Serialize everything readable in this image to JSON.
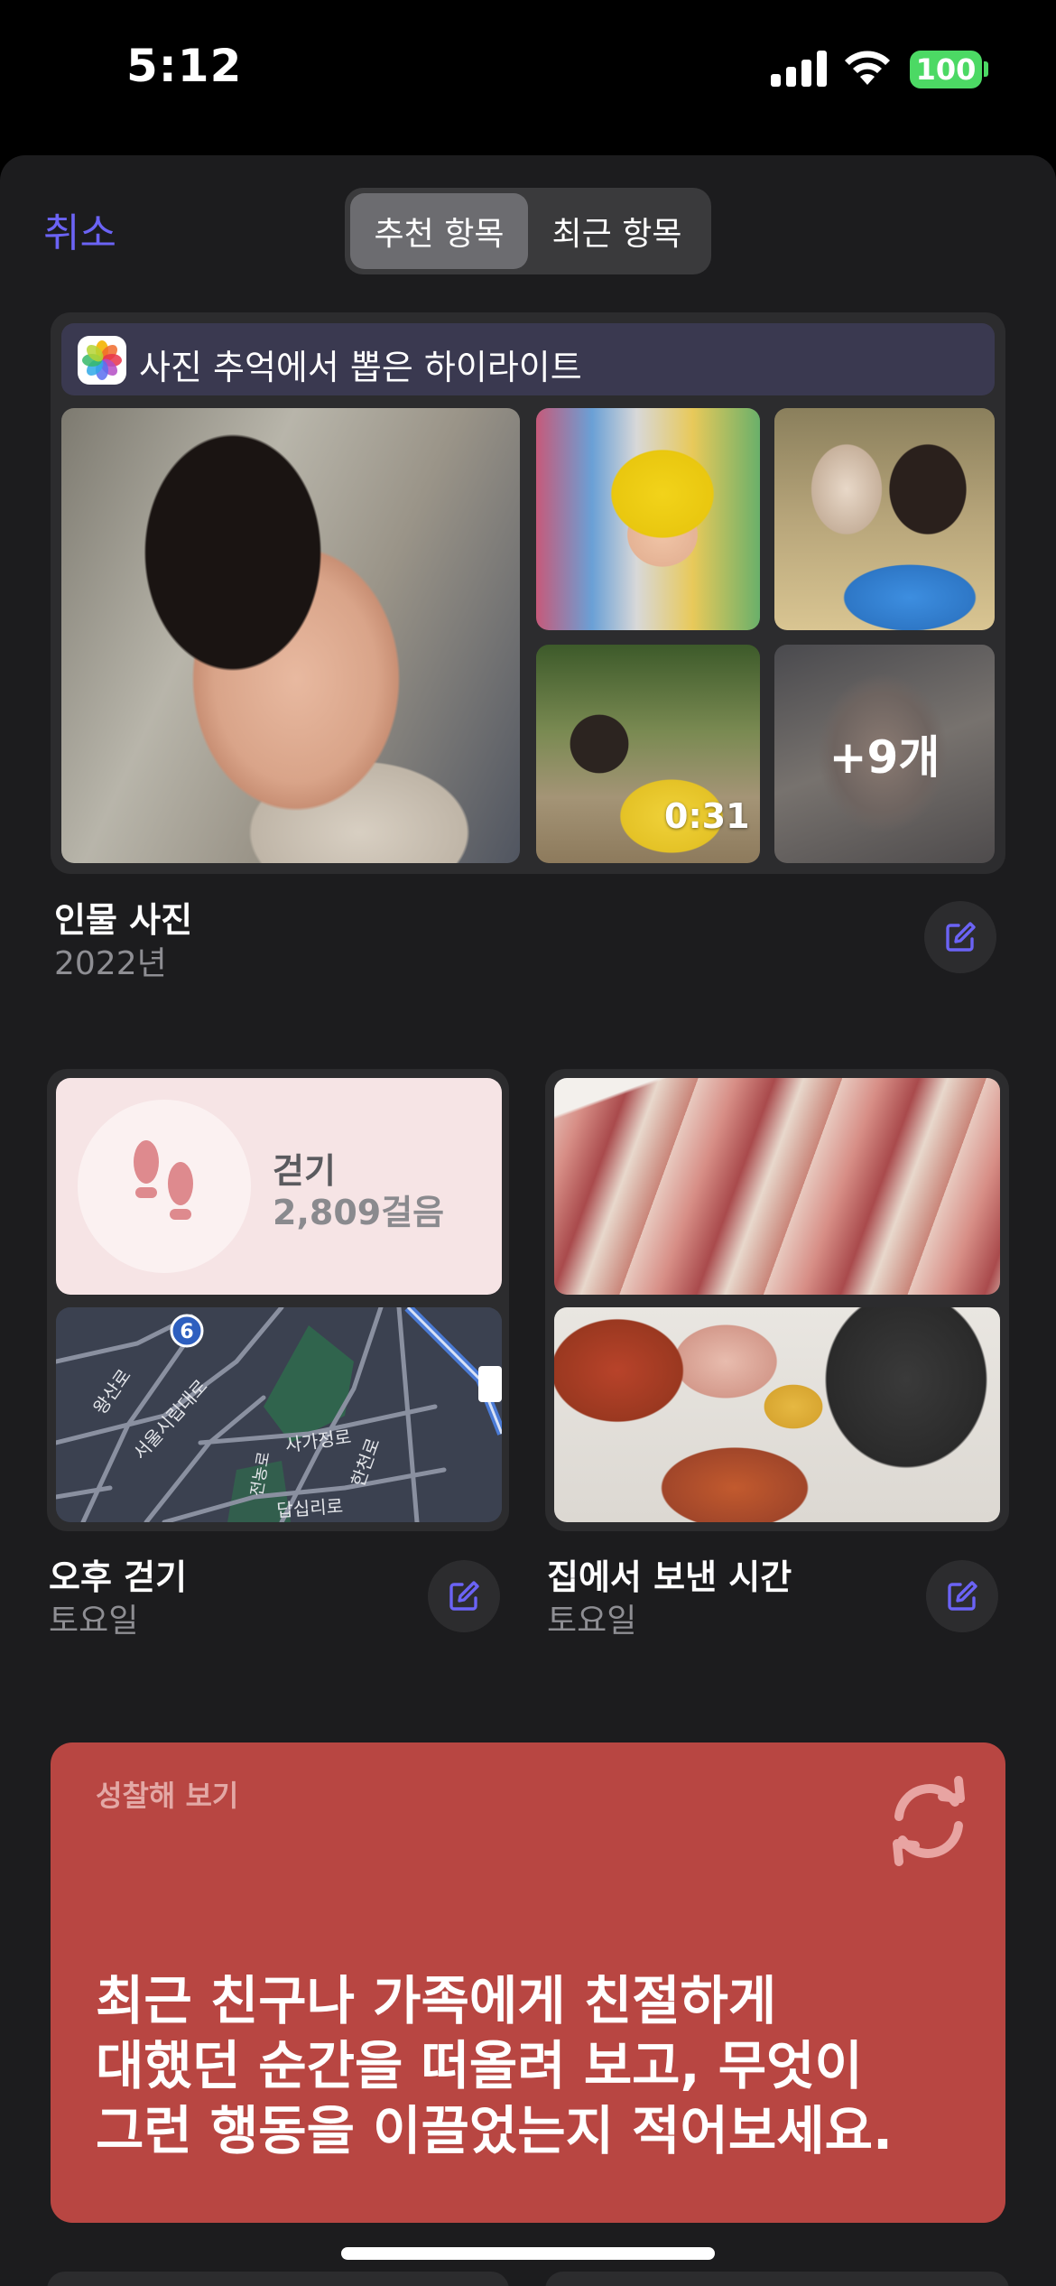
{
  "status_bar": {
    "time": "5:12",
    "battery": "100"
  },
  "header": {
    "cancel_label": "취소",
    "segments": [
      {
        "label": "추천 항목",
        "active": true
      },
      {
        "label": "최근 항목",
        "active": false
      }
    ]
  },
  "highlight_card": {
    "header_title": "사진 추억에서 뽑은 하이라이트",
    "video_duration": "0:31",
    "more_count": "+9개",
    "title": "인물 사진",
    "subtitle": "2022년"
  },
  "walk_card": {
    "activity": "걷기",
    "steps": "2,809걸음",
    "title": "오후 걷기",
    "subtitle": "토요일",
    "map_labels": [
      "6",
      "왕산로",
      "서울시립대로",
      "사가정로",
      "답십리로",
      "한천로",
      "전농로"
    ]
  },
  "home_card": {
    "title": "집에서 보낸 시간",
    "subtitle": "토요일"
  },
  "reflect_card": {
    "label": "성찰해 보기",
    "text": "최근 친구나 가족에게 친절하게\n대했던 순간을 떠올려 보고, 무엇이\n그런 행동을 이끌었는지 적어보세요."
  },
  "colors": {
    "accent": "#6b63f5",
    "sheet_bg": "#1c1c1e",
    "card_bg": "#2c2c2e",
    "reflect_bg": "#b84642",
    "battery": "#4cd964"
  },
  "icons": [
    "signal-icon",
    "wifi-icon",
    "battery-icon",
    "photos-app-icon",
    "edit-icon",
    "footprints-icon",
    "refresh-icon"
  ]
}
